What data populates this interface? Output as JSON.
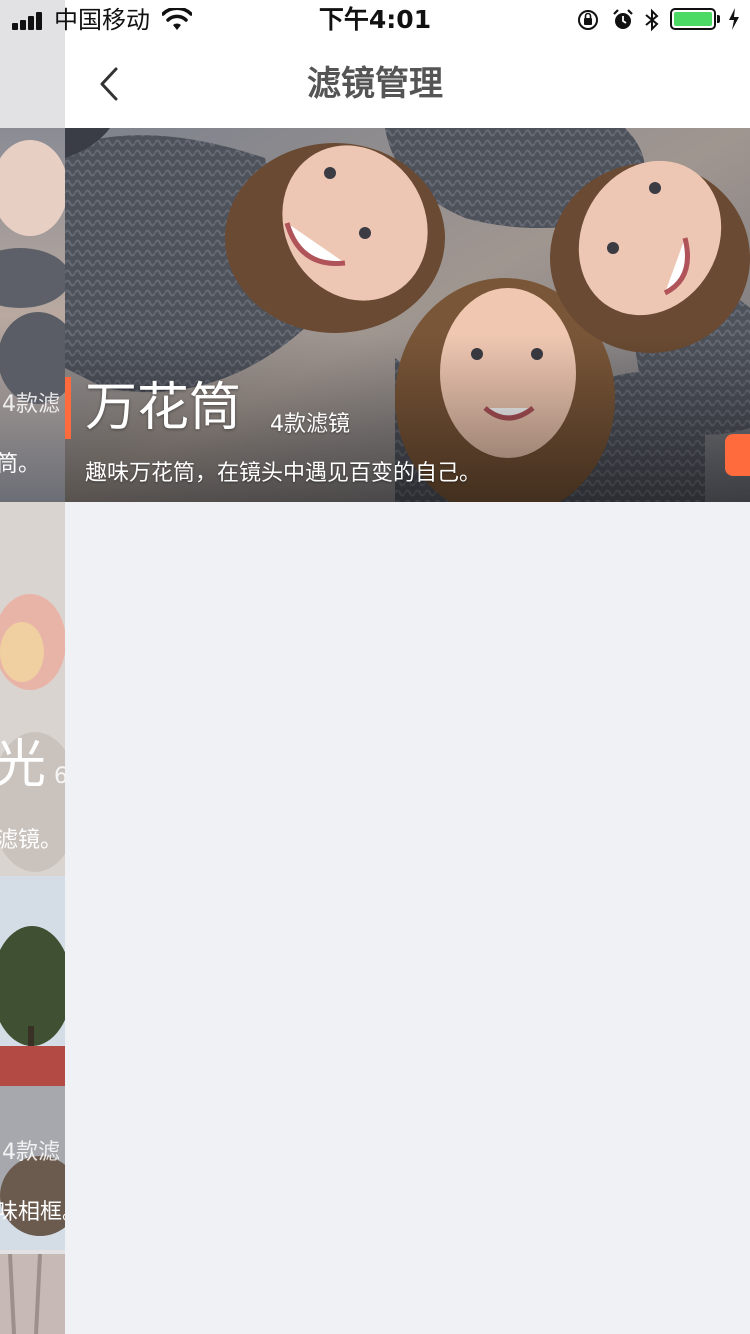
{
  "status_bar": {
    "carrier": "中国移动",
    "time": "下午4:01",
    "battery_percent": 100,
    "icons": [
      "signal-icon",
      "wifi-icon",
      "orientation-lock-icon",
      "alarm-icon",
      "bluetooth-icon",
      "battery-icon",
      "charging-icon"
    ]
  },
  "nav": {
    "title": "滤镜管理",
    "back_icon": "chevron-left-icon"
  },
  "banner": {
    "title": "万花筒",
    "count": "4款滤镜",
    "description": "趣味万花筒，在镜头中遇见百变的自己。"
  },
  "drawer": {
    "items": [
      {
        "count": "4款滤",
        "desc": "筒。"
      },
      {
        "title": "光",
        "count": "6",
        "desc": "滤镜。"
      },
      {
        "count": "4款滤",
        "desc": "味相框。"
      }
    ]
  },
  "colors": {
    "accent": "#ff6b3d",
    "background": "#f0f1f5",
    "battery": "#4cd964"
  }
}
